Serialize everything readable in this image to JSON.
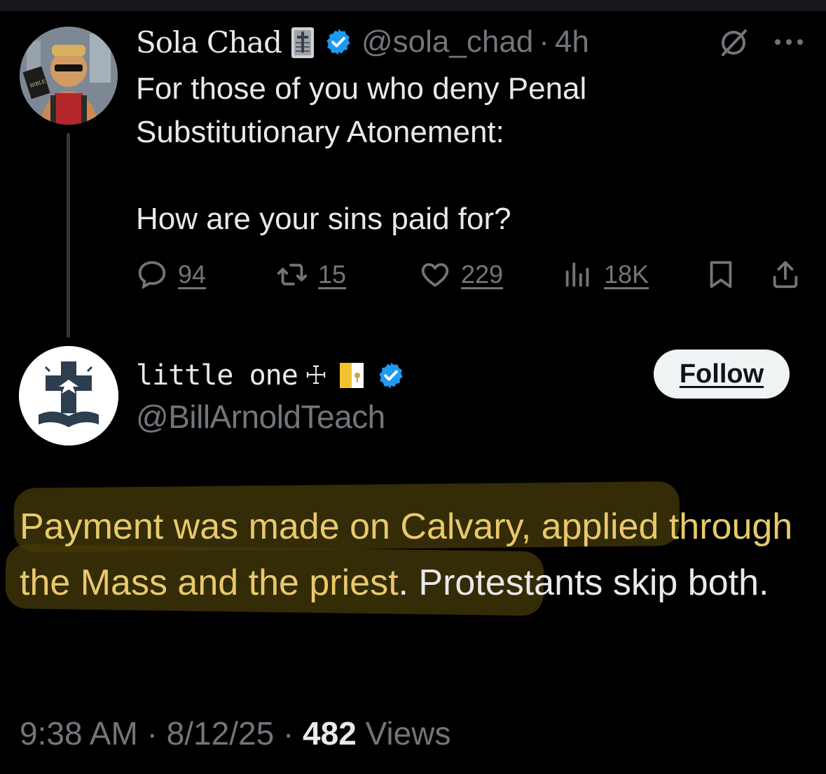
{
  "tweet": {
    "author": {
      "name": "Sola Chad",
      "handle": "@sola_chad",
      "time": "4h",
      "separator": "·"
    },
    "text_line1": "For those of you who deny Penal Substitutionary Atonement:",
    "text_line2": "How are your sins paid for?",
    "stats": {
      "replies": "94",
      "reposts": "15",
      "likes": "229",
      "views": "18K"
    }
  },
  "reply": {
    "author": {
      "name": "little one",
      "cross": "☩",
      "handle": "@BillArnoldTeach"
    },
    "follow_label": "Follow",
    "text_highlighted": "Payment was made on Calvary, applied through the Mass and the priest",
    "text_rest": ". Protestants skip both.",
    "time": "9:38 AM",
    "date": "8/12/25",
    "separator": "·",
    "views_count": "482",
    "views_label": "Views"
  },
  "icons": {
    "verified": "verified-badge-icon",
    "grok": "grok-icon",
    "more": "more-icon",
    "reply": "reply-icon",
    "repost": "repost-icon",
    "like": "heart-icon",
    "views": "views-icon",
    "bookmark": "bookmark-icon",
    "share": "share-icon"
  },
  "colors": {
    "background": "#000000",
    "text": "#e7e9ea",
    "secondary": "#71767b",
    "verified": "#1d9bf0",
    "highlight_text": "#e8c96a"
  }
}
